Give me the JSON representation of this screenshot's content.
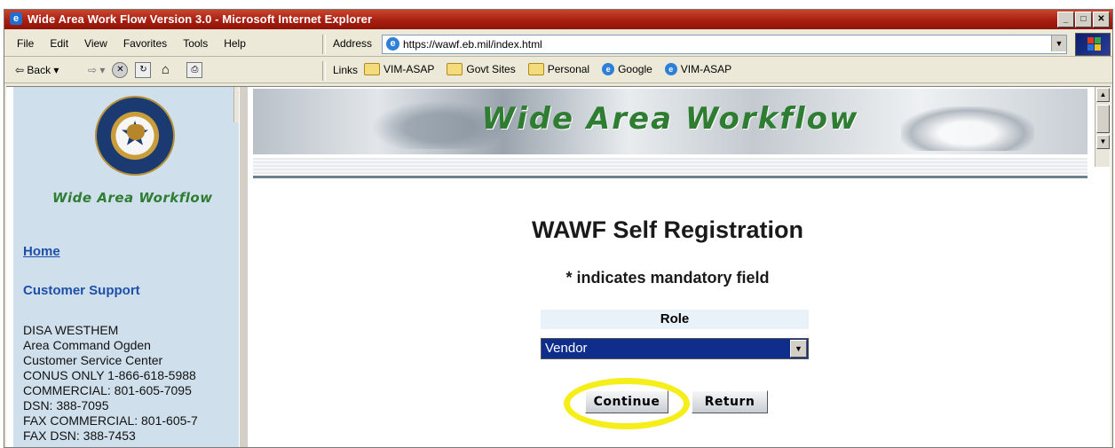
{
  "window": {
    "title": "Wide Area Work Flow Version 3.0 - Microsoft Internet Explorer",
    "buttons": [
      "_",
      "□",
      "✕"
    ]
  },
  "menu": {
    "items": [
      "File",
      "Edit",
      "View",
      "Favorites",
      "Tools",
      "Help"
    ]
  },
  "address": {
    "label": "Address",
    "url": "https://wawf.eb.mil/index.html"
  },
  "toolbar": {
    "back_label": "⇦ Back ▾",
    "forward": "⇨ ▾",
    "links_label": "Links",
    "links": [
      {
        "label": "VIM-ASAP",
        "icon": "folder-icon"
      },
      {
        "label": "Govt Sites",
        "icon": "folder-icon"
      },
      {
        "label": "Personal",
        "icon": "folder-icon"
      },
      {
        "label": "Google",
        "icon": "ie-page-icon"
      },
      {
        "label": "VIM-ASAP",
        "icon": "ie-page-icon"
      }
    ]
  },
  "sidebar": {
    "logo_text": "Wide Area Workflow",
    "home_link": "Home",
    "support_link": "Customer Support",
    "contact_lines": [
      "DISA WESTHEM",
      "Area Command Ogden",
      "Customer Service Center",
      "CONUS ONLY 1-866-618-5988",
      "COMMERCIAL: 801-605-7095",
      "DSN: 388-7095",
      "FAX COMMERCIAL: 801-605-7",
      "FAX DSN: 388-7453"
    ]
  },
  "main": {
    "banner_title": "Wide Area Workflow",
    "page_title": "WAWF Self Registration",
    "mandatory_note": "* indicates mandatory field",
    "role_label": "Role",
    "role_value": "Vendor",
    "continue_label": "Continue",
    "return_label": "Return",
    "highlight_color": "#f5ee1a"
  },
  "colors": {
    "titlebar": "#a81e10",
    "link": "#1f4fa8",
    "brand_green": "#2e7d32",
    "select_bg": "#0f2e8c"
  }
}
